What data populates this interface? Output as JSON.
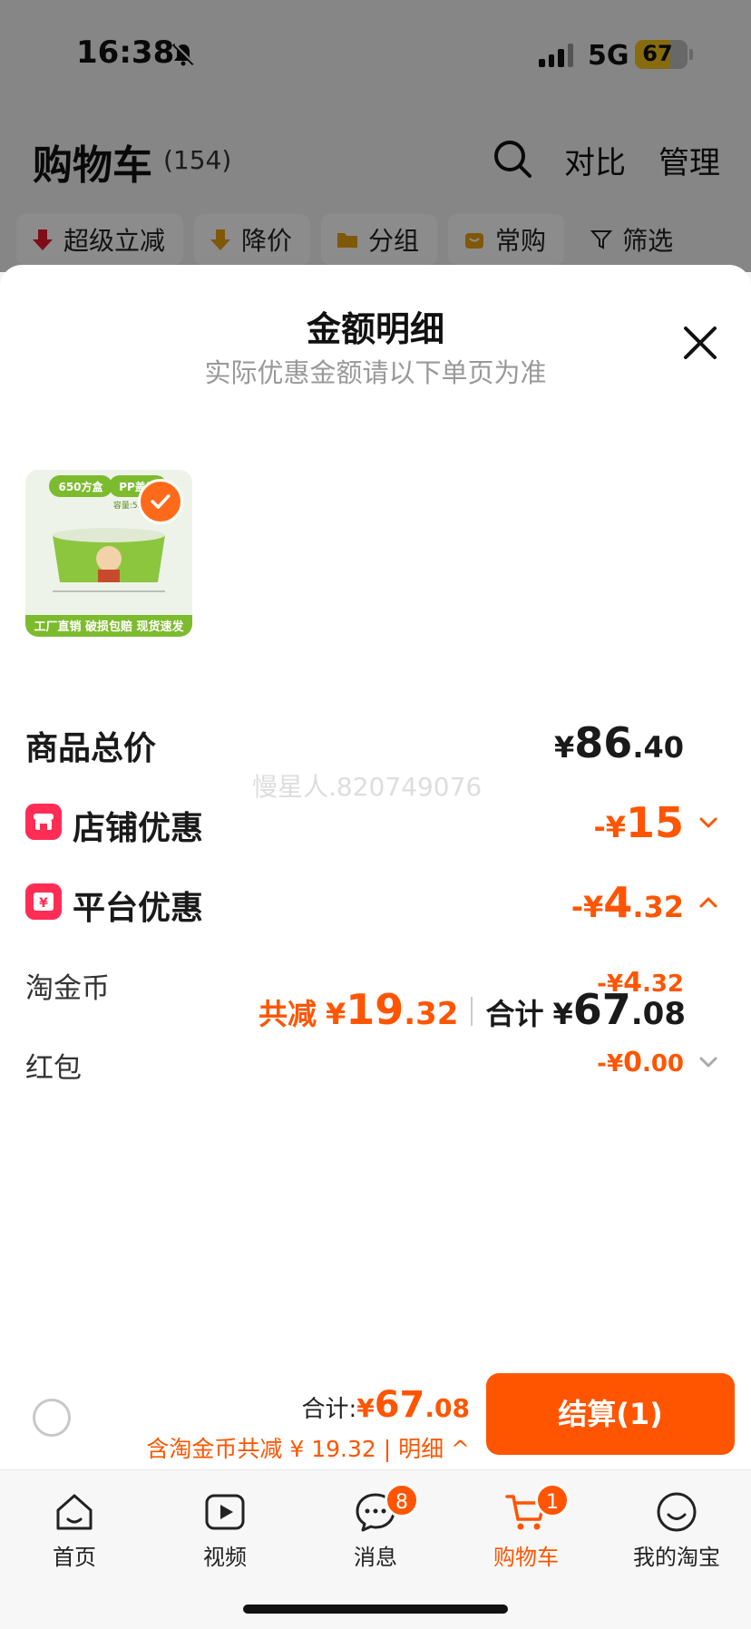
{
  "status_bar": {
    "time": "16:38",
    "network": "5G",
    "battery": "67"
  },
  "cart_header": {
    "title": "购物车",
    "count": "(154)",
    "compare": "对比",
    "manage": "管理"
  },
  "filters": [
    {
      "label": "超级立减",
      "icon": "red-down-arrow-icon"
    },
    {
      "label": "降价",
      "icon": "price-drop-icon"
    },
    {
      "label": "分组",
      "icon": "folder-icon"
    },
    {
      "label": "常购",
      "icon": "bag-icon"
    },
    {
      "label": "筛选",
      "icon": "filter-icon"
    }
  ],
  "sheet": {
    "title": "金额明细",
    "subtitle": "实际优惠金额请以下单页为准",
    "watermark": "慢星人.820749076",
    "product_thumb_texts": {
      "tag_left": "650方盒",
      "tag_right": "PP盖子",
      "capacity": "容量:550",
      "slogan": "工厂直销 破损包赔 现货速发"
    },
    "rows": [
      {
        "label": "商品总价",
        "symbol": "¥",
        "int": "86",
        "dec": ".40",
        "style": "dark"
      },
      {
        "label": "店铺优惠",
        "symbol": "-¥",
        "int": "15",
        "dec": "",
        "style": "orange",
        "icon": "shop-icon",
        "chevron": "chevron-down"
      },
      {
        "label": "平台优惠",
        "symbol": "-¥",
        "int": "4",
        "dec": ".32",
        "style": "orange",
        "icon": "coupon-icon",
        "chevron": "chevron-up"
      },
      {
        "label": "淘金币",
        "symbol": "-¥",
        "int": "4",
        "dec": ".32",
        "style": "orange-small"
      },
      {
        "label": "红包",
        "symbol": "-¥",
        "int": "0",
        "dec": ".00",
        "style": "orange-small",
        "chevron": "chevron-down"
      }
    ],
    "total_line": {
      "reduce_label": "共减",
      "reduce_symbol": "¥",
      "reduce_int": "19",
      "reduce_dec": ".32",
      "sum_label": "合计",
      "sum_symbol": "¥",
      "sum_int": "67",
      "sum_dec": ".08"
    }
  },
  "checkout": {
    "sum_label": "合计:",
    "sum_symbol": "¥",
    "sum_int": "67",
    "sum_dec": ".08",
    "note": "含淘金币共减 ¥ 19.32 | 明细 ^",
    "button": "结算(1)"
  },
  "tabbar": [
    {
      "label": "首页",
      "icon": "home-icon"
    },
    {
      "label": "视频",
      "icon": "video-icon"
    },
    {
      "label": "消息",
      "icon": "message-icon",
      "badge": "8"
    },
    {
      "label": "购物车",
      "icon": "cart-icon",
      "badge": "1",
      "active": true
    },
    {
      "label": "我的淘宝",
      "icon": "profile-icon"
    }
  ],
  "colors": {
    "accent": "#ff5500",
    "coupon_red": "#ff2d55"
  }
}
